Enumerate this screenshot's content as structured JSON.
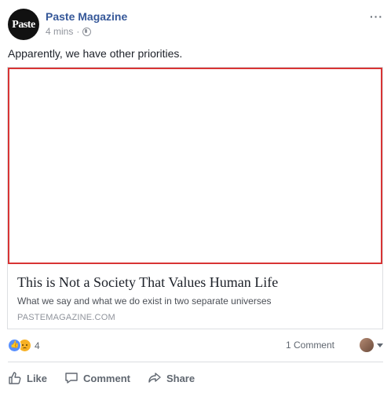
{
  "post": {
    "page_name": "Paste Magazine",
    "avatar_text": "Paste",
    "timestamp": "4 mins",
    "separator": "·",
    "text": "Apparently, we have other priorities."
  },
  "link": {
    "title": "This is Not a Society That Values Human Life",
    "description": "What we say and what we do exist in two separate universes",
    "domain": "PASTEMAGAZINE.COM"
  },
  "stats": {
    "reaction_count": "4",
    "comments_label": "1 Comment"
  },
  "actions": {
    "like": "Like",
    "comment": "Comment",
    "share": "Share"
  },
  "more_label": "···",
  "colors": {
    "page_name": "#365899",
    "image_border": "#d83434",
    "action_text": "#606770"
  }
}
